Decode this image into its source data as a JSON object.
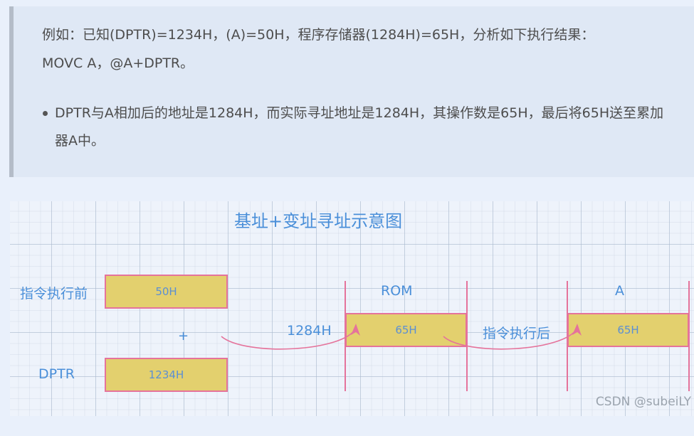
{
  "quote": {
    "line1": "例如：已知(DPTR)=1234H，(A)=50H，程序存储器(1284H)=65H，分析如下执行结果：",
    "line2": "MOVC A，@A+DPTR。",
    "bullet": "DPTR与A相加后的地址是1284H，而实际寻址地址是1284H，其操作数是65H，最后将65H送至累加器A中。"
  },
  "diagram": {
    "title": "基址+变址寻址示意图",
    "before_label": "指令执行前",
    "a_value": "50H",
    "plus": "+",
    "dptr_label": "DPTR",
    "dptr_value": "1234H",
    "rom_label": "ROM",
    "rom_address": "1284H",
    "rom_value": "65H",
    "after_label": "指令执行后",
    "acc_label": "A",
    "acc_value": "65H"
  },
  "watermark": "CSDN @subeiLY",
  "colors": {
    "box_fill": "#e3d06e",
    "box_border": "#e5739b",
    "label_blue": "#4a8fd9"
  }
}
